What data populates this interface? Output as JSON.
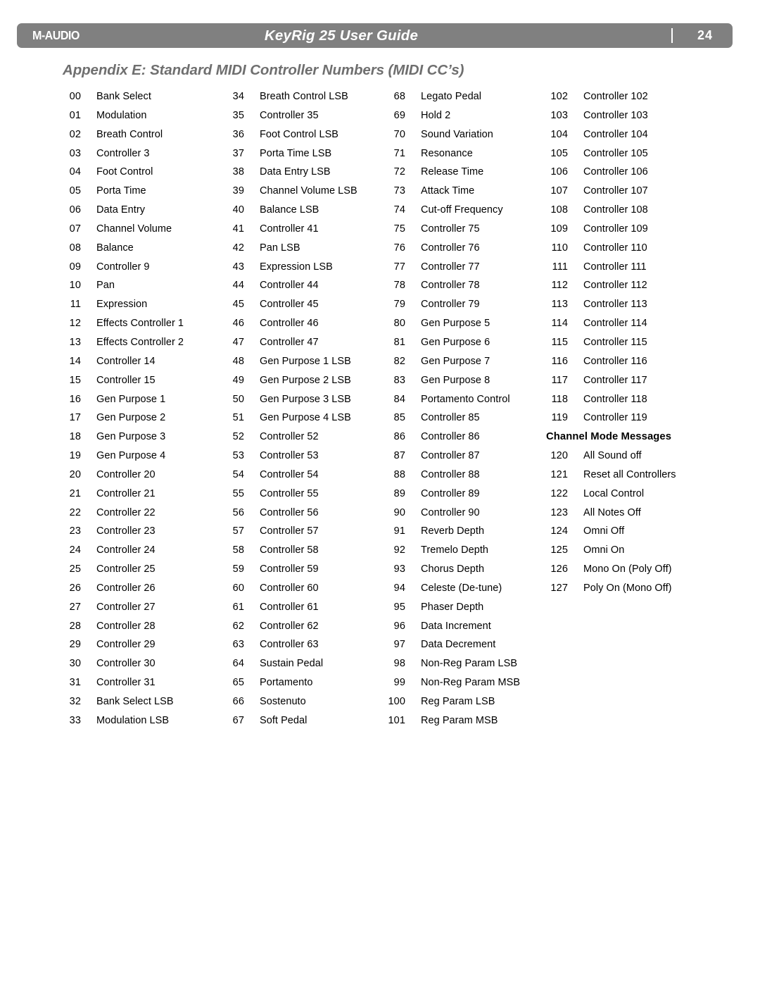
{
  "header": {
    "brand": "M-AUDIO",
    "title": "KeyRig 25 User Guide",
    "page_number": "24",
    "bar_color": "#808080",
    "text_color": "#ffffff"
  },
  "appendix": {
    "title": "Appendix E:  Standard MIDI Controller Numbers (MIDI CC’s)",
    "title_color": "#6f6f6f"
  },
  "table": {
    "columns": [
      {
        "rows": [
          {
            "num": "00",
            "label": "Bank Select"
          },
          {
            "num": "01",
            "label": "Modulation"
          },
          {
            "num": "02",
            "label": "Breath Control"
          },
          {
            "num": "03",
            "label": "Controller 3"
          },
          {
            "num": "04",
            "label": "Foot Control"
          },
          {
            "num": "05",
            "label": "Porta Time"
          },
          {
            "num": "06",
            "label": "Data Entry"
          },
          {
            "num": "07",
            "label": "Channel Volume"
          },
          {
            "num": "08",
            "label": "Balance"
          },
          {
            "num": "09",
            "label": "Controller 9"
          },
          {
            "num": "10",
            "label": "Pan"
          },
          {
            "num": "11",
            "label": "Expression"
          },
          {
            "num": "12",
            "label": "Effects Controller 1"
          },
          {
            "num": "13",
            "label": "Effects Controller 2"
          },
          {
            "num": "14",
            "label": "Controller 14"
          },
          {
            "num": "15",
            "label": "Controller 15"
          },
          {
            "num": "16",
            "label": "Gen Purpose 1"
          },
          {
            "num": "17",
            "label": "Gen Purpose 2"
          },
          {
            "num": "18",
            "label": "Gen Purpose 3"
          },
          {
            "num": "19",
            "label": "Gen Purpose 4"
          },
          {
            "num": "20",
            "label": "Controller 20"
          },
          {
            "num": "21",
            "label": "Controller 21"
          },
          {
            "num": "22",
            "label": "Controller 22"
          },
          {
            "num": "23",
            "label": "Controller 23"
          },
          {
            "num": "24",
            "label": "Controller 24"
          },
          {
            "num": "25",
            "label": "Controller 25"
          },
          {
            "num": "26",
            "label": "Controller 26"
          },
          {
            "num": "27",
            "label": "Controller 27"
          },
          {
            "num": "28",
            "label": "Controller 28"
          },
          {
            "num": "29",
            "label": "Controller 29"
          },
          {
            "num": "30",
            "label": "Controller 30"
          },
          {
            "num": "31",
            "label": "Controller 31"
          },
          {
            "num": "32",
            "label": "Bank Select LSB"
          },
          {
            "num": "33",
            "label": "Modulation LSB"
          }
        ]
      },
      {
        "rows": [
          {
            "num": "34",
            "label": "Breath Control LSB"
          },
          {
            "num": "35",
            "label": "Controller 35"
          },
          {
            "num": "36",
            "label": "Foot Control LSB"
          },
          {
            "num": "37",
            "label": "Porta Time LSB"
          },
          {
            "num": "38",
            "label": "Data Entry LSB"
          },
          {
            "num": "39",
            "label": "Channel Volume LSB"
          },
          {
            "num": "40",
            "label": "Balance LSB"
          },
          {
            "num": "41",
            "label": "Controller 41"
          },
          {
            "num": "42",
            "label": "Pan LSB"
          },
          {
            "num": "43",
            "label": "Expression LSB"
          },
          {
            "num": "44",
            "label": "Controller 44"
          },
          {
            "num": "45",
            "label": "Controller 45"
          },
          {
            "num": "46",
            "label": "Controller 46"
          },
          {
            "num": "47",
            "label": "Controller 47"
          },
          {
            "num": "48",
            "label": "Gen Purpose 1 LSB"
          },
          {
            "num": "49",
            "label": "Gen Purpose 2 LSB"
          },
          {
            "num": "50",
            "label": "Gen Purpose 3 LSB"
          },
          {
            "num": "51",
            "label": "Gen Purpose 4 LSB"
          },
          {
            "num": "52",
            "label": "Controller 52"
          },
          {
            "num": "53",
            "label": "Controller 53"
          },
          {
            "num": "54",
            "label": "Controller 54"
          },
          {
            "num": "55",
            "label": "Controller 55"
          },
          {
            "num": "56",
            "label": "Controller 56"
          },
          {
            "num": "57",
            "label": "Controller 57"
          },
          {
            "num": "58",
            "label": "Controller 58"
          },
          {
            "num": "59",
            "label": "Controller 59"
          },
          {
            "num": "60",
            "label": "Controller 60"
          },
          {
            "num": "61",
            "label": "Controller 61"
          },
          {
            "num": "62",
            "label": "Controller 62"
          },
          {
            "num": "63",
            "label": "Controller 63"
          },
          {
            "num": "64",
            "label": "Sustain Pedal"
          },
          {
            "num": "65",
            "label": "Portamento"
          },
          {
            "num": "66",
            "label": "Sostenuto"
          },
          {
            "num": "67",
            "label": "Soft Pedal"
          }
        ]
      },
      {
        "rows": [
          {
            "num": "68",
            "label": "Legato Pedal"
          },
          {
            "num": "69",
            "label": "Hold 2"
          },
          {
            "num": "70",
            "label": "Sound Variation"
          },
          {
            "num": "71",
            "label": "Resonance"
          },
          {
            "num": "72",
            "label": "Release Time"
          },
          {
            "num": "73",
            "label": "Attack Time"
          },
          {
            "num": "74",
            "label": "Cut-off Frequency"
          },
          {
            "num": "75",
            "label": "Controller 75"
          },
          {
            "num": "76",
            "label": "Controller 76"
          },
          {
            "num": "77",
            "label": "Controller 77"
          },
          {
            "num": "78",
            "label": "Controller 78"
          },
          {
            "num": "79",
            "label": "Controller 79"
          },
          {
            "num": "80",
            "label": "Gen Purpose 5"
          },
          {
            "num": "81",
            "label": "Gen Purpose 6"
          },
          {
            "num": "82",
            "label": "Gen Purpose 7"
          },
          {
            "num": "83",
            "label": "Gen Purpose 8"
          },
          {
            "num": "84",
            "label": "Portamento Control"
          },
          {
            "num": "85",
            "label": "Controller 85"
          },
          {
            "num": "86",
            "label": "Controller 86"
          },
          {
            "num": "87",
            "label": "Controller 87"
          },
          {
            "num": "88",
            "label": "Controller 88"
          },
          {
            "num": "89",
            "label": "Controller 89"
          },
          {
            "num": "90",
            "label": "Controller 90"
          },
          {
            "num": "91",
            "label": "Reverb Depth"
          },
          {
            "num": "92",
            "label": "Tremelo Depth"
          },
          {
            "num": "93",
            "label": "Chorus Depth"
          },
          {
            "num": "94",
            "label": "Celeste (De-tune)"
          },
          {
            "num": "95",
            "label": "Phaser Depth"
          },
          {
            "num": "96",
            "label": "Data Increment"
          },
          {
            "num": "97",
            "label": "Data Decrement"
          },
          {
            "num": "98",
            "label": "Non-Reg Param LSB"
          },
          {
            "num": "99",
            "label": "Non-Reg Param MSB"
          },
          {
            "num": "100",
            "label": "Reg Param LSB"
          },
          {
            "num": "101",
            "label": "Reg Param MSB"
          }
        ]
      },
      {
        "rows": [
          {
            "num": "102",
            "label": "Controller 102"
          },
          {
            "num": "103",
            "label": "Controller 103"
          },
          {
            "num": "104",
            "label": "Controller 104"
          },
          {
            "num": "105",
            "label": "Controller 105"
          },
          {
            "num": "106",
            "label": "Controller 106"
          },
          {
            "num": "107",
            "label": "Controller 107"
          },
          {
            "num": "108",
            "label": "Controller 108"
          },
          {
            "num": "109",
            "label": "Controller 109"
          },
          {
            "num": "110",
            "label": "Controller 110"
          },
          {
            "num": "111",
            "label": "Controller 111"
          },
          {
            "num": "112",
            "label": "Controller 112"
          },
          {
            "num": "113",
            "label": "Controller 113"
          },
          {
            "num": "114",
            "label": "Controller 114"
          },
          {
            "num": "115",
            "label": "Controller 115"
          },
          {
            "num": "116",
            "label": "Controller 116"
          },
          {
            "num": "117",
            "label": "Controller 117"
          },
          {
            "num": "118",
            "label": "Controller 118"
          },
          {
            "num": "119",
            "label": "Controller 119"
          },
          {
            "heading": "Channel Mode Messages"
          },
          {
            "num": "120",
            "label": "All Sound off"
          },
          {
            "num": "121",
            "label": "Reset all Controllers"
          },
          {
            "num": "122",
            "label": "Local Control"
          },
          {
            "num": "123",
            "label": "All Notes Off"
          },
          {
            "num": "124",
            "label": "Omni Off"
          },
          {
            "num": "125",
            "label": "Omni On"
          },
          {
            "num": "126",
            "label": "Mono On (Poly Off)"
          },
          {
            "num": "127",
            "label": "Poly On (Mono Off)"
          }
        ]
      }
    ]
  }
}
